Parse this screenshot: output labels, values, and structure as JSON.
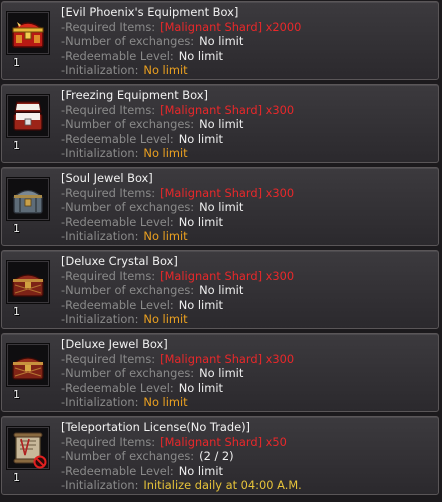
{
  "labels": {
    "required": "-Required Items:",
    "exchanges": "-Number of exchanges:",
    "level": "-Redeemable Level:",
    "init": "-Initialization:"
  },
  "items": [
    {
      "title": "[Evil Phoenix's Equipment Box]",
      "qty": "1",
      "required": "[Malignant Shard] x2000",
      "exchanges": "No limit",
      "level": "No limit",
      "init": "No limit",
      "icon": "red-gold-chest-icon"
    },
    {
      "title": "[Freezing Equipment Box]",
      "qty": "1",
      "required": "[Malignant Shard] x300",
      "exchanges": "No limit",
      "level": "No limit",
      "init": "No limit",
      "icon": "open-white-chest-icon"
    },
    {
      "title": "[Soul Jewel Box]",
      "qty": "1",
      "required": "[Malignant Shard] x300",
      "exchanges": "No limit",
      "level": "No limit",
      "init": "No limit",
      "icon": "steel-chest-icon"
    },
    {
      "title": "[Deluxe Crystal Box]",
      "qty": "1",
      "required": "[Malignant Shard] x300",
      "exchanges": "No limit",
      "level": "No limit",
      "init": "No limit",
      "icon": "deluxe-crystal-chest-icon"
    },
    {
      "title": "[Deluxe Jewel Box]",
      "qty": "1",
      "required": "[Malignant Shard] x300",
      "exchanges": "No limit",
      "level": "No limit",
      "init": "No limit",
      "icon": "deluxe-jewel-chest-icon"
    },
    {
      "title": "[Teleportation License(No Trade)]",
      "qty": "1",
      "required": "[Malignant Shard] x50",
      "exchanges": "(2 / 2)",
      "level": "No limit",
      "init": "Initialize daily at 04:00 A.M.",
      "icon": "scroll-license-icon"
    }
  ],
  "colors": {
    "title": "#f2f2f2",
    "label": "#8a8a8a",
    "required_value": "#e8282a",
    "init_value": "#eaa020",
    "init_daily_value": "#e6c33a"
  }
}
